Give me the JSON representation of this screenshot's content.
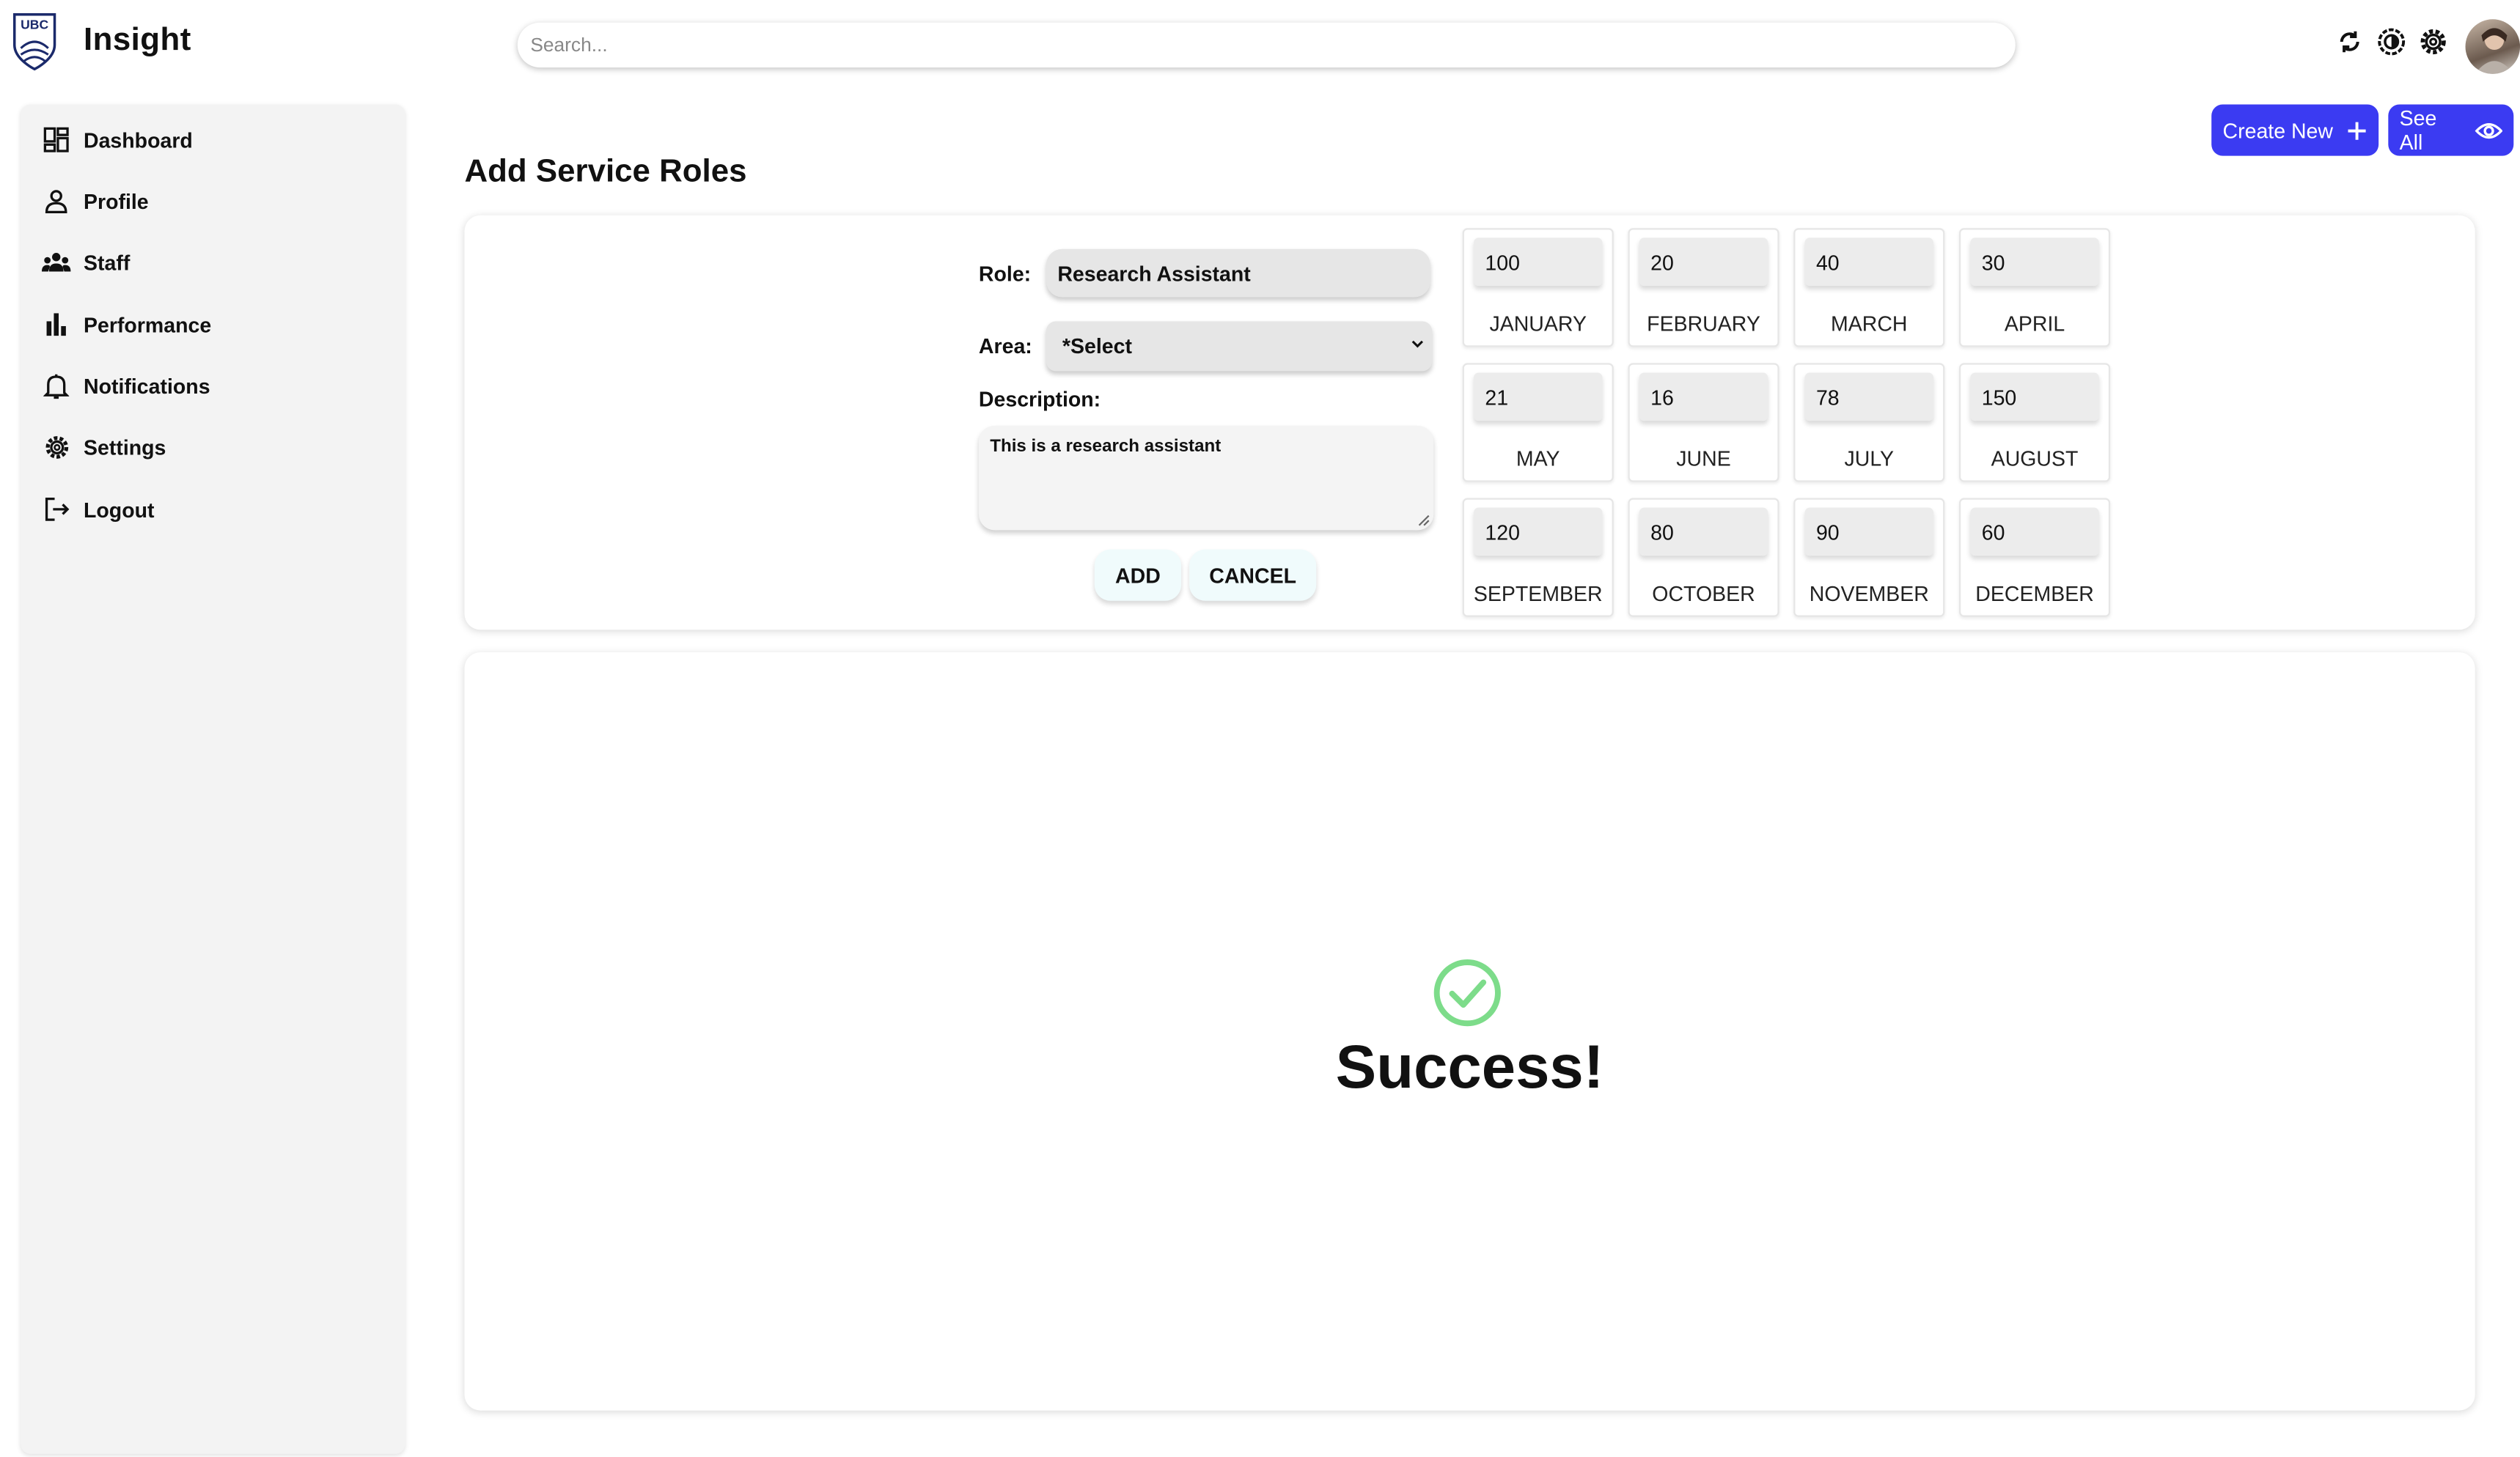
{
  "app": {
    "name": "Insight",
    "logo_text": "UBC"
  },
  "search": {
    "placeholder": "Search..."
  },
  "header_icons": [
    "sync-icon",
    "theme-icon",
    "settings-icon"
  ],
  "sidebar": {
    "items": [
      {
        "label": "Dashboard",
        "icon": "dashboard-icon"
      },
      {
        "label": "Profile",
        "icon": "person-icon"
      },
      {
        "label": "Staff",
        "icon": "group-icon"
      },
      {
        "label": "Performance",
        "icon": "bar-chart-icon"
      },
      {
        "label": "Notifications",
        "icon": "bell-icon"
      },
      {
        "label": "Settings",
        "icon": "gear-icon"
      },
      {
        "label": "Logout",
        "icon": "logout-icon"
      }
    ]
  },
  "actions": {
    "create_new": "Create New",
    "see_all": "See All"
  },
  "page": {
    "title": "Add Service Roles"
  },
  "form": {
    "role_label": "Role:",
    "role_value": "Research Assistant",
    "area_label": "Area:",
    "area_value": "*Select",
    "description_label": "Description:",
    "description_value": "This is a research assistant",
    "add_label": "ADD",
    "cancel_label": "CANCEL"
  },
  "months": [
    {
      "name": "JANUARY",
      "value": "100"
    },
    {
      "name": "FEBRUARY",
      "value": "20"
    },
    {
      "name": "MARCH",
      "value": "40"
    },
    {
      "name": "APRIL",
      "value": "30"
    },
    {
      "name": "MAY",
      "value": "21"
    },
    {
      "name": "JUNE",
      "value": "16"
    },
    {
      "name": "JULY",
      "value": "78"
    },
    {
      "name": "AUGUST",
      "value": "150"
    },
    {
      "name": "SEPTEMBER",
      "value": "120"
    },
    {
      "name": "OCTOBER",
      "value": "80"
    },
    {
      "name": "NOVEMBER",
      "value": "90"
    },
    {
      "name": "DECEMBER",
      "value": "60"
    }
  ],
  "result": {
    "message": "Success!",
    "icon": "check-circle-icon",
    "color": "#7ddc8a"
  },
  "colors": {
    "accent": "#3b3bf2"
  }
}
